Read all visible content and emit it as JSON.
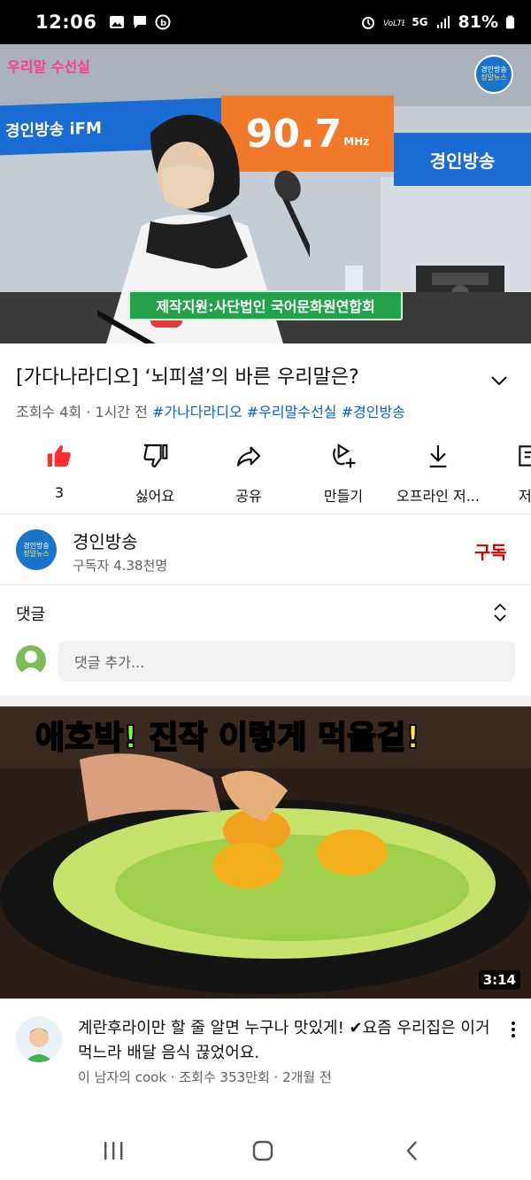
{
  "status_bar": {
    "time": "12:06",
    "network": "5G",
    "battery": "81%"
  },
  "player": {
    "program_tag": "우리말 수선실",
    "channel_logo_top": "경인방송",
    "channel_logo_bottom": "정말뉴스",
    "fm_banner": "경인방송 iFM",
    "frequency": "90.7",
    "frequency_unit": "MHz",
    "right_banner": "경인방송",
    "sponsor_caption": "제작지원:사단법인 국어문화원연합회"
  },
  "video": {
    "title": "[가다나라디오] ‘뇌피셜’의 바른 우리말은?",
    "views": "조회수 4회",
    "age": "1시간 전",
    "hashtags": [
      "#가나다라디오",
      "#우리말수선실",
      "#경인방송"
    ]
  },
  "actions": [
    {
      "label": "3",
      "icon": "thumbs-up-icon"
    },
    {
      "label": "싫어요",
      "icon": "thumbs-down-icon"
    },
    {
      "label": "공유",
      "icon": "share-icon"
    },
    {
      "label": "만들기",
      "icon": "remix-icon"
    },
    {
      "label": "오프라인 저...",
      "icon": "download-icon"
    },
    {
      "label": "저",
      "icon": "save-icon"
    }
  ],
  "channel": {
    "avatar_top": "경인방송",
    "avatar_bottom": "정말뉴스",
    "name": "경인방송",
    "subscribers": "구독자 4.38천명",
    "subscribe_label": "구독"
  },
  "comments": {
    "title": "댓글",
    "placeholder": "댓글 추가..."
  },
  "recommended": {
    "headline_1": "애호박!",
    "headline_2": "진작 이렇게",
    "headline_3": "먹을걸!",
    "duration": "3:14",
    "title": "계란후라이만 할 줄 알면 누구나 맛있게! ✔요즘 우리집은 이거 먹느라 배달 음식 끊었어요.",
    "channel": "이 남자의 cook",
    "views": "조회수 353만회",
    "age": "2개월 전"
  },
  "colors": {
    "accent_red": "#cc0000",
    "link_blue": "#065fd4",
    "like_red": "#ff2d2d"
  }
}
